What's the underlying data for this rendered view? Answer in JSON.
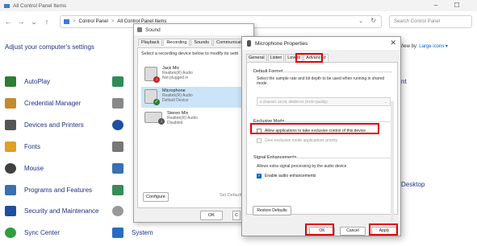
{
  "control_panel": {
    "window_title": "All Control Panel Items",
    "window_controls": {
      "minimize": "–",
      "maximize": "☐"
    },
    "nav": {
      "back": "←",
      "forward": "→",
      "dropdown": "⌄",
      "up": "↑"
    },
    "breadcrumb": [
      "Control Panel",
      "All Control Panel Items"
    ],
    "breadcrumb_sep": ">",
    "address_dropdown": "⌄",
    "address_refresh": "↻",
    "search_placeholder": "Search Control Panel",
    "heading": "Adjust your computer's settings",
    "view_by_label": "View by:",
    "view_by_value": "Large icons ▾",
    "items_left": [
      {
        "label": "AutoPlay",
        "icon": "autoplay-icon",
        "color": "#2e7d32"
      },
      {
        "label": "Credential Manager",
        "icon": "credential-manager-icon",
        "color": "#c48a2c"
      },
      {
        "label": "Devices and Printers",
        "icon": "devices-printers-icon",
        "color": "#555555"
      },
      {
        "label": "Fonts",
        "icon": "fonts-icon",
        "color": "#e0a020"
      },
      {
        "label": "Mouse",
        "icon": "mouse-icon",
        "color": "#404040"
      },
      {
        "label": "Programs and Features",
        "icon": "programs-features-icon",
        "color": "#3a6fb0"
      },
      {
        "label": "Security and Maintenance",
        "icon": "security-flag-icon",
        "color": "#1e4fa0"
      },
      {
        "label": "Sync Center",
        "icon": "sync-center-icon",
        "color": "#2e9e3e"
      }
    ],
    "items_mid_peek": [
      {
        "label": "",
        "icon": "cp-item-icon",
        "color": "#2e8b57"
      },
      {
        "label": "",
        "icon": "cp-item-icon",
        "color": "#888888"
      },
      {
        "label": "",
        "icon": "cp-item-icon",
        "color": "#1e4fa0"
      },
      {
        "label": "",
        "icon": "cp-item-icon",
        "color": "#777777"
      },
      {
        "label": "",
        "icon": "cp-item-icon",
        "color": "#3a6fb0"
      },
      {
        "label": "",
        "icon": "cp-item-icon",
        "color": "#3a8a5a"
      },
      {
        "label": "",
        "icon": "cp-item-icon",
        "color": "#999999"
      },
      {
        "label": "System",
        "icon": "system-icon",
        "color": "#2a6bc0"
      }
    ],
    "right_peek": {
      "item_1": "nt",
      "item_2": "Desktop"
    }
  },
  "sound_dialog": {
    "title": "Sound",
    "tabs": [
      "Playback",
      "Recording",
      "Sounds",
      "Communications"
    ],
    "active_tab": "Recording",
    "instruction": "Select a recording device below to modify its setti",
    "devices": [
      {
        "name": "Jack Mic",
        "driver": "Realtek(R) Audio",
        "status": "Not plugged in",
        "badge": "↓",
        "badge_color": "#c62828"
      },
      {
        "name": "Microphone",
        "driver": "Realtek(R) Audio",
        "status": "Default Device",
        "badge": "✓",
        "badge_color": "#2e7d32"
      },
      {
        "name": "Stereo Mix",
        "driver": "Realtek(R) Audio",
        "status": "Disabled",
        "badge": "↓",
        "badge_color": "#555555"
      }
    ],
    "configure_label": "Configure",
    "set_default_label": "Set Default",
    "ok_label": "OK",
    "cancel_label": "C"
  },
  "mic_dialog": {
    "title": "Microphone Properties",
    "close": "✕",
    "tabs": [
      "General",
      "Listen",
      "Levels",
      "Advanced"
    ],
    "active_tab": "Advanced",
    "default_format_title": "Default Format",
    "default_format_desc": "Select the sample rate and bit depth to be used when running in shared mode.",
    "format_value": "2 channel, 16 bit, 48000 Hz (DVD Quality)",
    "exclusive_mode_title": "Exclusive Mode",
    "exclusive_allow": "Allow applications to take exclusive control of this device",
    "exclusive_priority": "Give exclusive mode applications priority",
    "signal_title": "Signal Enhancements",
    "signal_desc": "Allows extra signal processing by the audio device",
    "enable_enhancements": "Enable audio enhancements",
    "restore_label": "Restore Defaults",
    "ok_label": "OK",
    "cancel_label": "Cancel",
    "apply_label": "Apply",
    "checkbox_mark": "✓",
    "highlight_color": "#e00000"
  }
}
